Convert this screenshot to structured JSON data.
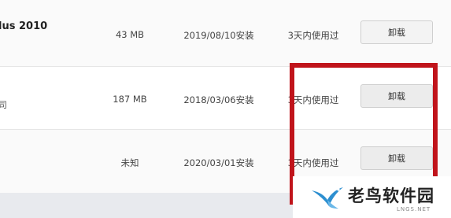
{
  "apps": [
    {
      "name": "lus 2010",
      "subname": "",
      "size": "43 MB",
      "installed": "2019/08/10安装",
      "last_used": "3天内使用过",
      "action": "卸载"
    },
    {
      "name": "",
      "subname": "司",
      "size": "187 MB",
      "installed": "2018/03/06安装",
      "last_used": "3天内使用过",
      "action": "卸载"
    },
    {
      "name": "",
      "subname": "",
      "size": "未知",
      "installed": "2020/03/01安装",
      "last_used": "3天内使用过",
      "action": "卸载"
    }
  ],
  "watermark": {
    "title": "老鸟软件园",
    "url": "LNGS.NET"
  },
  "colors": {
    "highlight": "#c0141b"
  }
}
